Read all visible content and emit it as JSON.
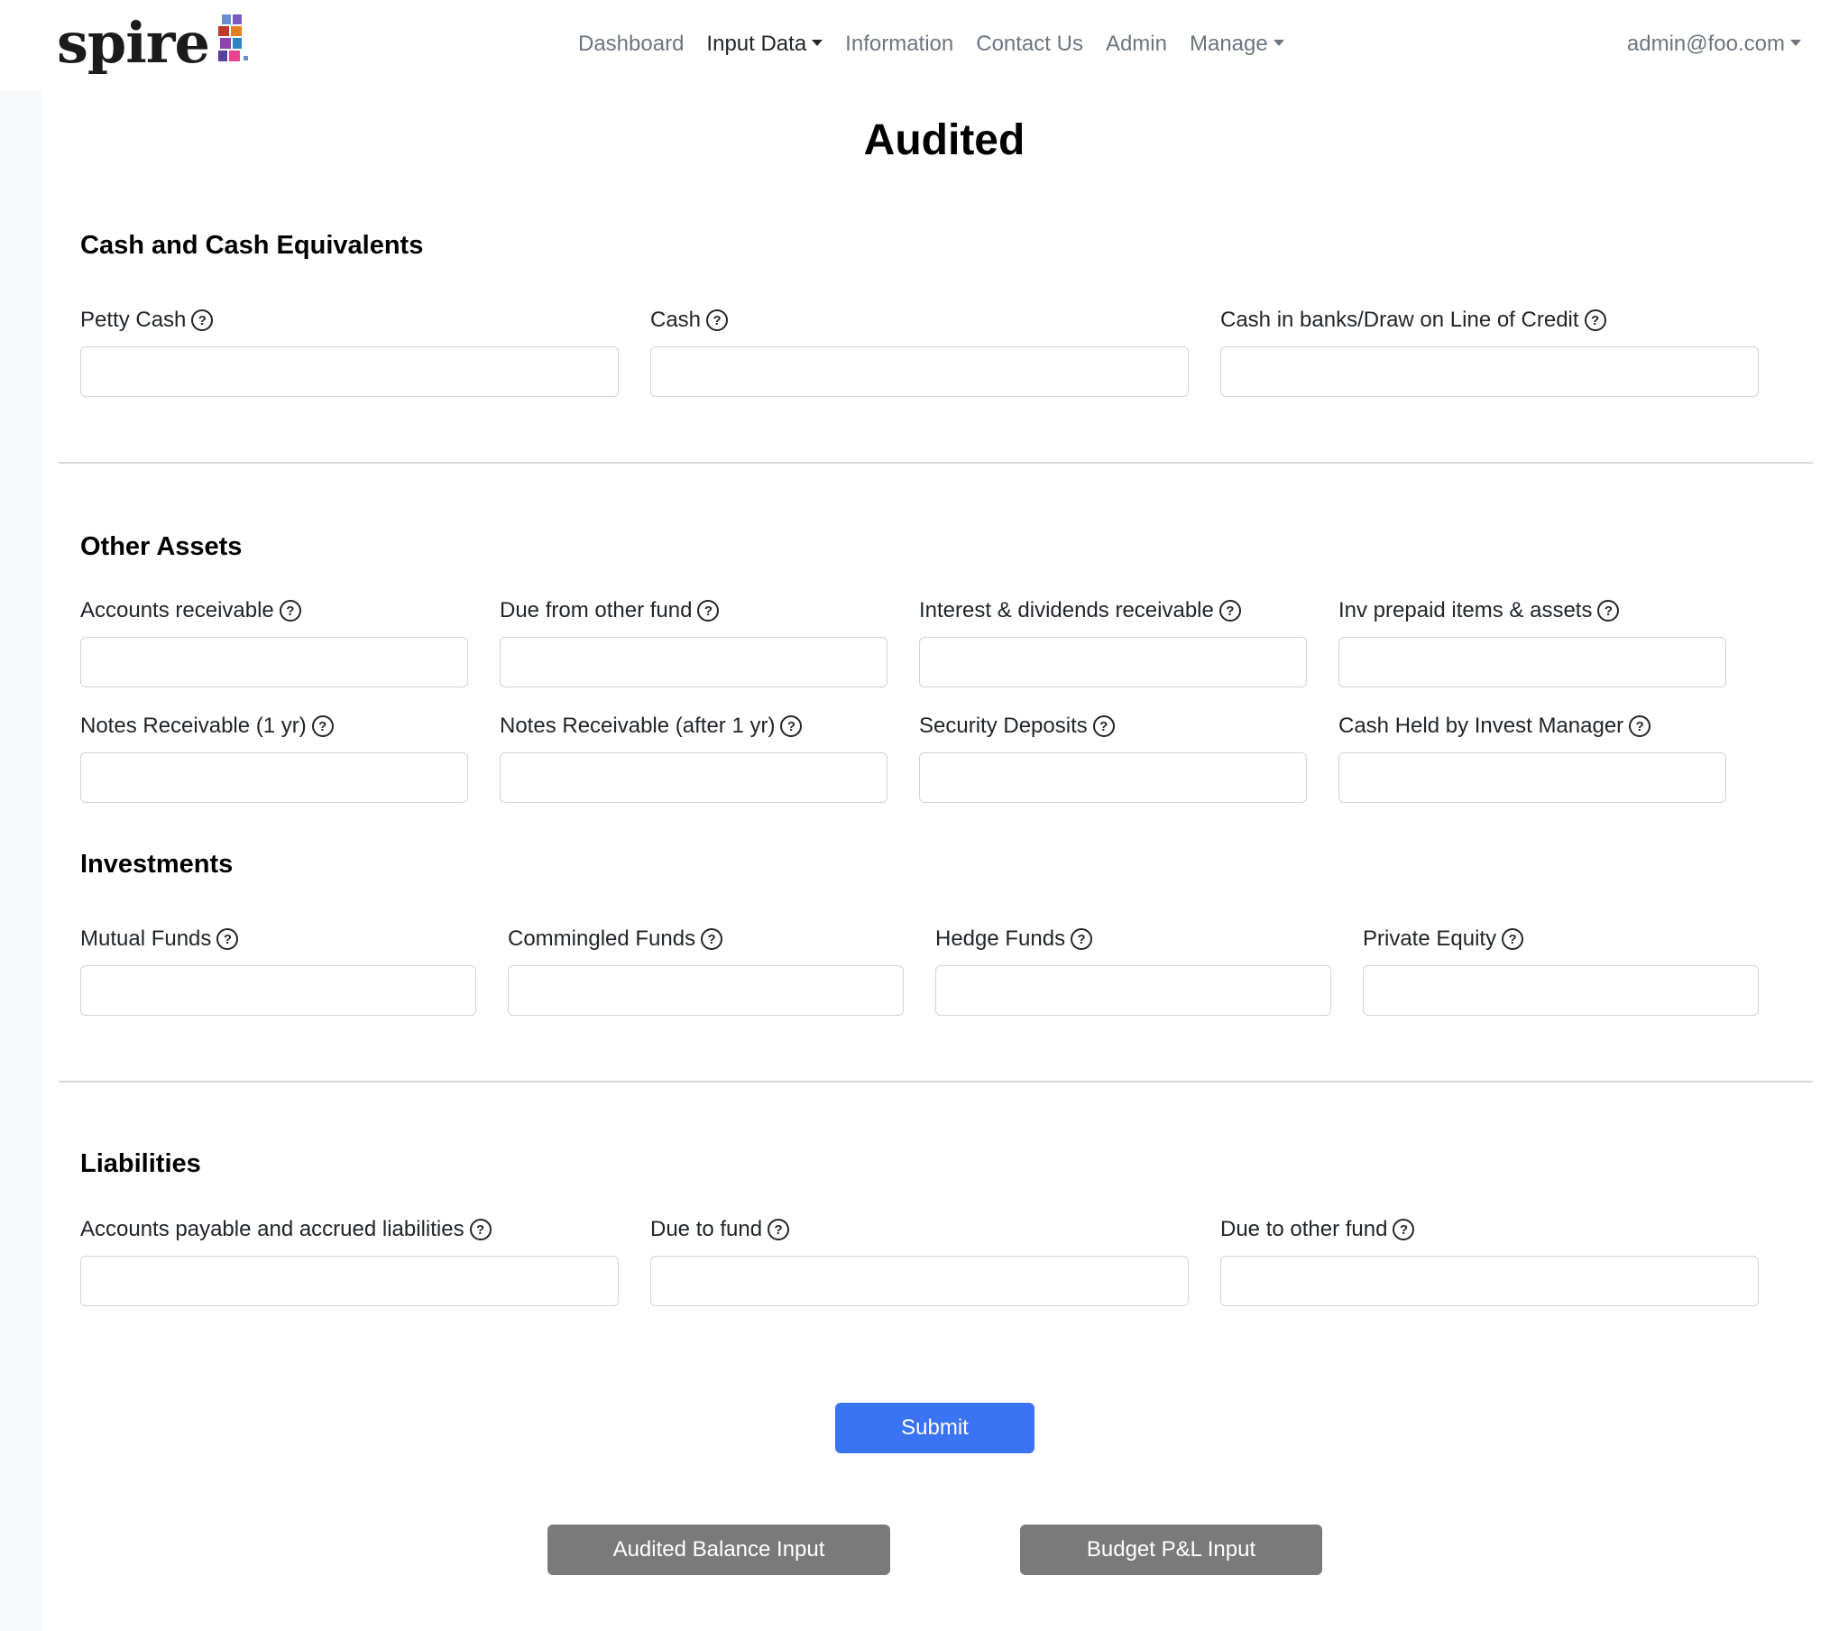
{
  "brand": {
    "name": "spire"
  },
  "nav": {
    "links": [
      {
        "label": "Dashboard"
      },
      {
        "label": "Input Data"
      },
      {
        "label": "Information"
      },
      {
        "label": "Contact Us"
      },
      {
        "label": "Admin"
      },
      {
        "label": "Manage"
      }
    ],
    "user": "admin@foo.com"
  },
  "page": {
    "title": "Audited"
  },
  "sections": {
    "cash": {
      "title": "Cash and Cash Equivalents",
      "fields": [
        {
          "label": "Petty Cash",
          "value": ""
        },
        {
          "label": "Cash",
          "value": ""
        },
        {
          "label": "Cash in banks/Draw on Line of Credit",
          "value": ""
        }
      ]
    },
    "other_assets": {
      "title": "Other Assets",
      "fields": [
        {
          "label": "Accounts receivable",
          "value": ""
        },
        {
          "label": "Due from other fund",
          "value": ""
        },
        {
          "label": "Interest & dividends receivable",
          "value": ""
        },
        {
          "label": "Inv prepaid items & assets",
          "value": ""
        },
        {
          "label": "Notes Receivable (1 yr)",
          "value": ""
        },
        {
          "label": "Notes Receivable (after 1 yr)",
          "value": ""
        },
        {
          "label": "Security Deposits",
          "value": ""
        },
        {
          "label": "Cash Held by Invest Manager",
          "value": ""
        }
      ]
    },
    "investments": {
      "title": "Investments",
      "fields": [
        {
          "label": "Mutual Funds",
          "value": ""
        },
        {
          "label": "Commingled Funds",
          "value": ""
        },
        {
          "label": "Hedge Funds",
          "value": ""
        },
        {
          "label": "Private Equity",
          "value": ""
        }
      ]
    },
    "liabilities": {
      "title": "Liabilities",
      "fields": [
        {
          "label": "Accounts payable and accrued liabilities",
          "value": ""
        },
        {
          "label": "Due to fund",
          "value": ""
        },
        {
          "label": "Due to other fund",
          "value": ""
        }
      ]
    }
  },
  "help_icon": "question-circle-icon",
  "buttons": {
    "submit": "Submit",
    "audited_balance": "Audited Balance Input",
    "budget_pl": "Budget P&L Input"
  },
  "colors": {
    "primary": "#3b73f5",
    "secondary": "#7a7a7a",
    "logo_squares": [
      "#6a5acd",
      "#c0392b",
      "#e67e22",
      "#8e44ad",
      "#2e86c1",
      "#e84393"
    ]
  }
}
